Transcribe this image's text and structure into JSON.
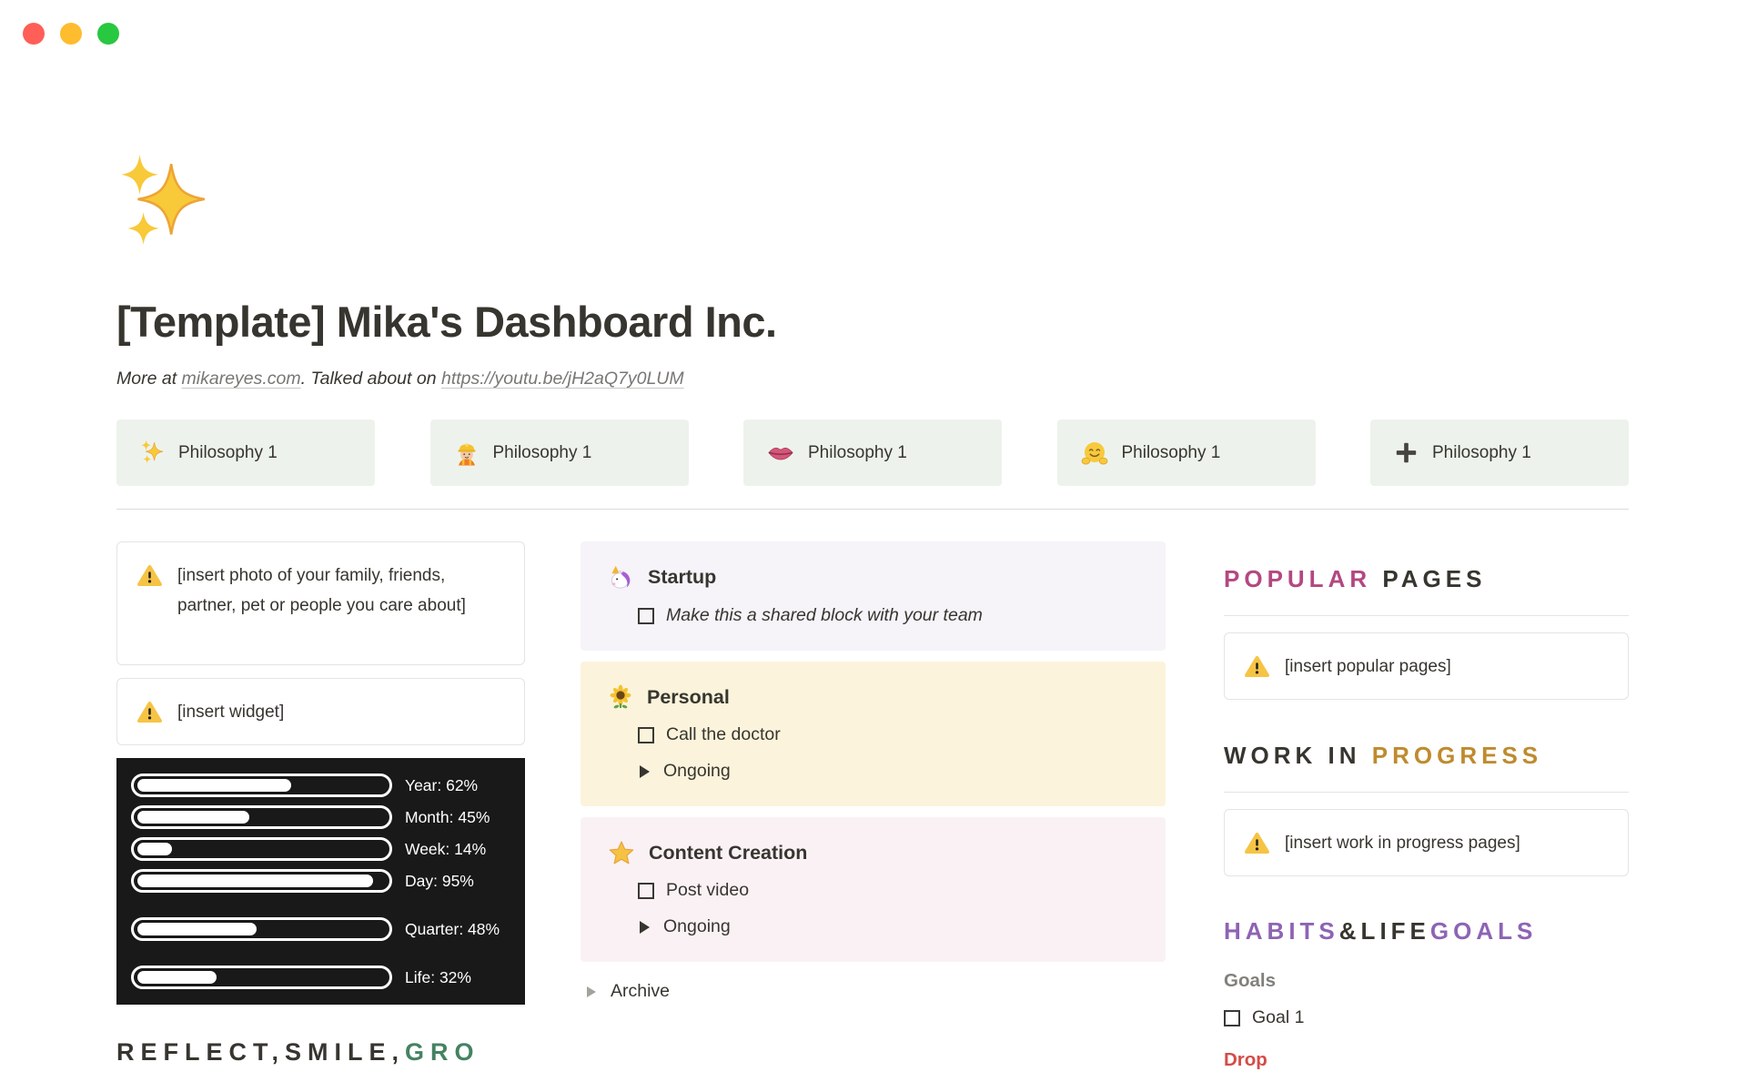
{
  "window": {
    "controls": [
      {
        "name": "close",
        "color": "#ff5f57"
      },
      {
        "name": "minimize",
        "color": "#febc2e"
      },
      {
        "name": "zoom",
        "color": "#28c840"
      }
    ]
  },
  "header": {
    "page_icon": "sparkles-icon",
    "title": "[Template] Mika's Dashboard Inc.",
    "subtitle": {
      "text_before": "More at ",
      "link1": "mikareyes.com",
      "text_middle": ". Talked about on ",
      "link2": "https://youtu.be/jH2aQ7y0LUM"
    }
  },
  "philosophy_buttons": [
    {
      "icon": "sparkles-icon",
      "label": "Philosophy 1"
    },
    {
      "icon": "construction-worker-icon",
      "label": "Philosophy 1"
    },
    {
      "icon": "lips-icon",
      "label": "Philosophy 1"
    },
    {
      "icon": "hugging-face-icon",
      "label": "Philosophy 1"
    },
    {
      "icon": "plus-icon",
      "label": "Philosophy 1"
    }
  ],
  "left_column": {
    "photo_callout": {
      "icon": "warning-icon",
      "text": "[insert photo of your family, friends, partner, pet or people you care about]"
    },
    "widget_callout": {
      "icon": "warning-icon",
      "text": "[insert widget]"
    },
    "progress_widget": {
      "background": "#191919",
      "bars": [
        {
          "label": "Year: 62%",
          "percent": 62
        },
        {
          "label": "Month: 45%",
          "percent": 45
        },
        {
          "label": "Week: 14%",
          "percent": 14
        },
        {
          "label": "Day: 95%",
          "percent": 95
        },
        {
          "label": "Quarter: 48%",
          "percent": 48
        },
        {
          "label": "Life: 32%",
          "percent": 32
        }
      ]
    },
    "motto": {
      "parts": [
        {
          "text": "REFLECT,SMILE,",
          "color": "#37352f"
        },
        {
          "text": "GRO",
          "color": "#458262"
        }
      ]
    }
  },
  "center_column": {
    "cards": [
      {
        "icon": "unicorn-icon",
        "title": "Startup",
        "bg": "#f6f3f9",
        "items": [
          {
            "type": "todo",
            "text": "Make this a shared block with your team",
            "italic": true,
            "checked": false
          }
        ]
      },
      {
        "icon": "sunflower-icon",
        "title": "Personal",
        "bg": "#fbf3db",
        "items": [
          {
            "type": "todo",
            "text": "Call the doctor",
            "checked": false
          },
          {
            "type": "toggle",
            "text": "Ongoing"
          }
        ]
      },
      {
        "icon": "star-icon",
        "title": "Content Creation",
        "bg": "#faf1f5",
        "items": [
          {
            "type": "todo",
            "text": "Post video",
            "checked": false
          },
          {
            "type": "toggle",
            "text": "Ongoing"
          }
        ]
      }
    ],
    "archive_label": "Archive"
  },
  "right_column": {
    "sections": [
      {
        "title_parts": [
          {
            "text": "POPULAR ",
            "color": "#b34880"
          },
          {
            "text": "PAGES",
            "color": "#37352f"
          }
        ],
        "note": {
          "icon": "warning-icon",
          "text": "[insert popular pages]"
        }
      },
      {
        "title_parts": [
          {
            "text": "WORK IN ",
            "color": "#37352f"
          },
          {
            "text": "PROGRESS",
            "color": "#bf8b2e"
          }
        ],
        "note": {
          "icon": "warning-icon",
          "text": "[insert work in progress pages]"
        }
      }
    ],
    "habits": {
      "title_parts": [
        {
          "text": "HABITS",
          "color": "#8e63b4"
        },
        {
          "text": "&LIFE",
          "color": "#37352f"
        },
        {
          "text": "GOALS",
          "color": "#8e63b4"
        }
      ],
      "subheading": "Goals",
      "goal_todo": {
        "text": "Goal 1",
        "checked": false
      },
      "drop_label": "Drop",
      "drop_color": "#d44c47"
    }
  }
}
